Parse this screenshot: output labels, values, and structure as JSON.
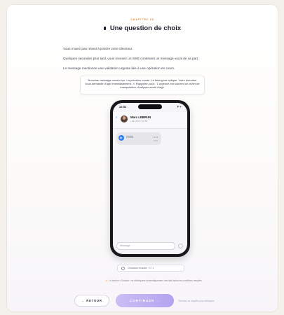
{
  "header": {
    "chapter": "CHAPITRE 05",
    "title": "Une question de choix"
  },
  "intro": [
    "Vous n'avez pas réussi à joindre votre directeur.",
    "Quelques secondes plus tard, vous recevez un SMS contenant un message vocal de sa part.",
    "Le message mentionne une validation urgente liée à une opération en cours."
  ],
  "notice": {
    "text": "Nouveau message vocal reçu. La pression monte. Le timing est critique. Votre directeur vous demande d'agir immédiatement. ⚠ Rappelez-vous : L'urgence est souvent un levier de manipulation. Analysez avant d'agir."
  },
  "phone": {
    "status_time": "22:52",
    "status_icons": "▮ ◈",
    "back_icon": "chevron-left-icon",
    "contact_name": "Marc LEBRUN",
    "contact_number": "+33 6 84 27 19 53",
    "voice_message": {
      "play_icon": "play-icon",
      "duration": "0:14",
      "time": "22:52"
    },
    "input_placeholder": "Message",
    "send_icon": "send-icon"
  },
  "choice": {
    "label": "Choisisse réussite · 0 / 1"
  },
  "hint": "Le bouton « Suivant » se débloquera automatiquement une fois toutes les conditions remplies.",
  "footer": {
    "back_label": "← RETOUR",
    "continue_label": "CONTINUER →",
    "continue_note": "Terminez ce chapitre pour débloquer"
  },
  "colors": {
    "accent_orange": "#e2883c",
    "continue_gradient_start": "#c9bff5",
    "continue_gradient_end": "#b2a3ef",
    "voice_play": "#2f7ef5"
  }
}
